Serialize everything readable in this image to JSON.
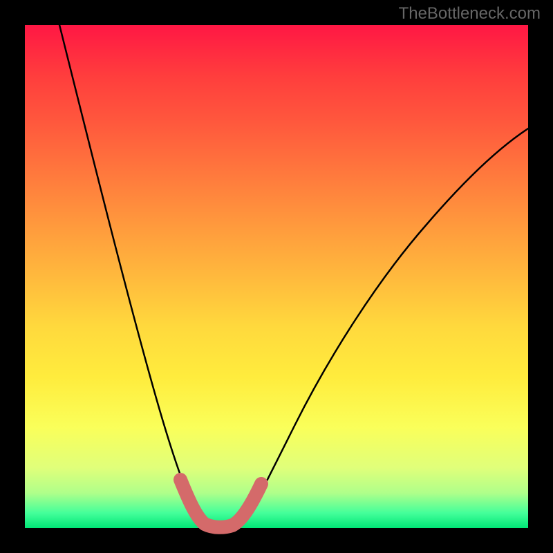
{
  "watermark": "TheBottleneck.com",
  "chart_data": {
    "type": "line",
    "title": "",
    "xlabel": "",
    "ylabel": "",
    "x": [
      0.07,
      0.1,
      0.14,
      0.18,
      0.22,
      0.26,
      0.3,
      0.33,
      0.35,
      0.37,
      0.39,
      0.42,
      0.44,
      0.48,
      0.54,
      0.62,
      0.72,
      0.82,
      0.92,
      1.0
    ],
    "values": [
      1.0,
      0.88,
      0.74,
      0.6,
      0.46,
      0.3,
      0.15,
      0.06,
      0.02,
      0.0,
      0.0,
      0.02,
      0.05,
      0.12,
      0.24,
      0.4,
      0.56,
      0.68,
      0.76,
      0.8
    ],
    "xlim": [
      0,
      1
    ],
    "ylim": [
      0,
      1
    ],
    "background_gradient": {
      "type": "vertical",
      "stops": [
        {
          "pos": 0.0,
          "color": "#ff1744"
        },
        {
          "pos": 0.5,
          "color": "#ffb93d"
        },
        {
          "pos": 0.8,
          "color": "#faff5a"
        },
        {
          "pos": 1.0,
          "color": "#00e676"
        }
      ]
    },
    "highlight_region": {
      "x_range": [
        0.31,
        0.47
      ],
      "color": "#d46a6a",
      "description": "trough of curve"
    },
    "annotations": []
  },
  "colors": {
    "page_background": "#000000",
    "curve": "#000000",
    "highlight": "#d46a6a",
    "watermark": "#666666"
  }
}
